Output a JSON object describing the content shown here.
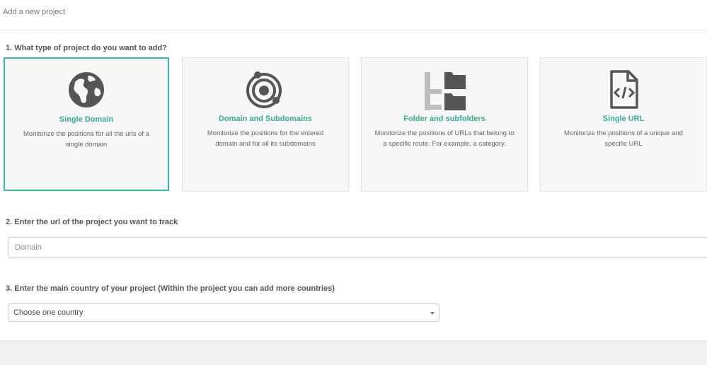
{
  "header": {
    "title": "Add a new project"
  },
  "step1": {
    "question": "1. What type of project do you want to add?",
    "cards": [
      {
        "title": "Single Domain",
        "description": "Monitorize the positions for all the urls of a single domain",
        "icon": "globe-icon",
        "selected": true
      },
      {
        "title": "Domain and Subdomains",
        "description": "Monitorize the positions for the entered domain and for all its subdomains",
        "icon": "orbit-icon",
        "selected": false
      },
      {
        "title": "Folder and subfolders",
        "description": "Monitorize the positions of URLs that belong to a specific route. For example, a category.",
        "icon": "folder-tree-icon",
        "selected": false
      },
      {
        "title": "Single URL",
        "description": "Monitorize the positions of a unique and specific URL",
        "icon": "code-file-icon",
        "selected": false
      }
    ]
  },
  "step2": {
    "question": "2. Enter the url of the project you want to track",
    "placeholder": "Domain",
    "value": ""
  },
  "step3": {
    "question": "3. Enter the main country of your project (Within the project you can add more countries)",
    "selected_option": "Choose one country"
  },
  "colors": {
    "accent": "#3bb8a0",
    "title_text": "#3aa894",
    "icon_dark": "#555555",
    "icon_light": "#bdbdbd",
    "card_bg": "#f7f7f7"
  }
}
